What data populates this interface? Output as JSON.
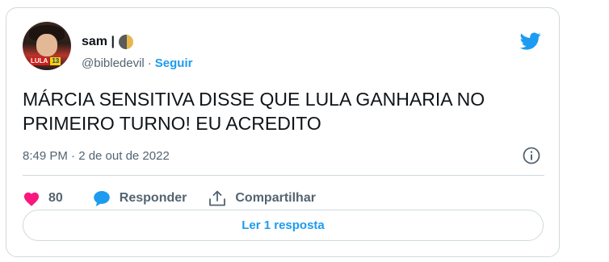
{
  "user": {
    "display_name": "sam |",
    "name_emoji": "moon-icon",
    "handle": "@bibledevil",
    "separator": "·",
    "follow_label": "Seguir",
    "avatar_badge": {
      "party": "LULA",
      "number": "13"
    }
  },
  "tweet": {
    "text": "MÁRCIA SENSITIVA DISSE QUE LULA GANHARIA NO PRIMEIRO TURNO! EU ACREDITO",
    "timestamp": "8:49 PM · 2 de out de 2022"
  },
  "actions": {
    "like_count": "80",
    "reply_label": "Responder",
    "share_label": "Compartilhar"
  },
  "footer": {
    "read_replies_label": "Ler 1 resposta"
  },
  "colors": {
    "accent": "#1d9bf0",
    "like": "#f91880",
    "muted": "#536471",
    "border": "#cfd9de"
  }
}
